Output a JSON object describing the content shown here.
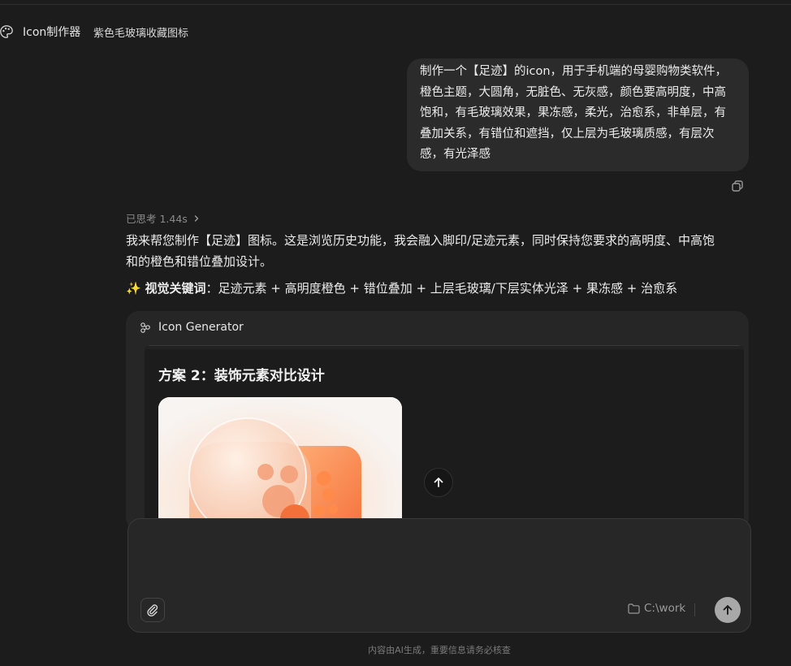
{
  "header": {
    "app_title": "Icon制作器",
    "conversation_title": "紫色毛玻璃收藏图标"
  },
  "user_message": {
    "lines": [
      "制作一个【足迹】的icon，用于手机端的母婴购物类软件，",
      "橙色主题，大圆角，无脏色、无灰感，颜色要高明度，中高",
      "饱和，有毛玻璃效果，果冻感，柔光，治愈系，非单层，有",
      "叠加关系，有错位和遮挡，仅上层为毛玻璃质感，有层次",
      "感，有光泽感"
    ]
  },
  "assistant": {
    "thought_label": "已思考 1.44s",
    "reply_lines": [
      "我来帮您制作【足迹】图标。这是浏览历史功能，我会融入脚印/足迹元素，同时保持您要求的高明度、中高饱",
      "和的橙色和错位叠加设计。"
    ],
    "keywords_emoji": "✨",
    "keywords_label": "视觉关键词",
    "keywords_value": "：足迹元素 + 高明度橙色 + 错位叠加 + 上层毛玻璃/下层实体光泽 + 果冻感 + 治愈系"
  },
  "tool_card": {
    "title": "Icon Generator",
    "plan_title": "方案 2：装饰元素对比设计"
  },
  "composer": {
    "folder": "C:\\work"
  },
  "footer": {
    "note": "内容由AI生成，重要信息请务必核查"
  },
  "colors": {
    "background": "#1c1c1c",
    "bubble": "#2b2b2b",
    "card": "#262626",
    "accent_orange": "#f57b3a",
    "send_button": "#a8a8a8"
  }
}
